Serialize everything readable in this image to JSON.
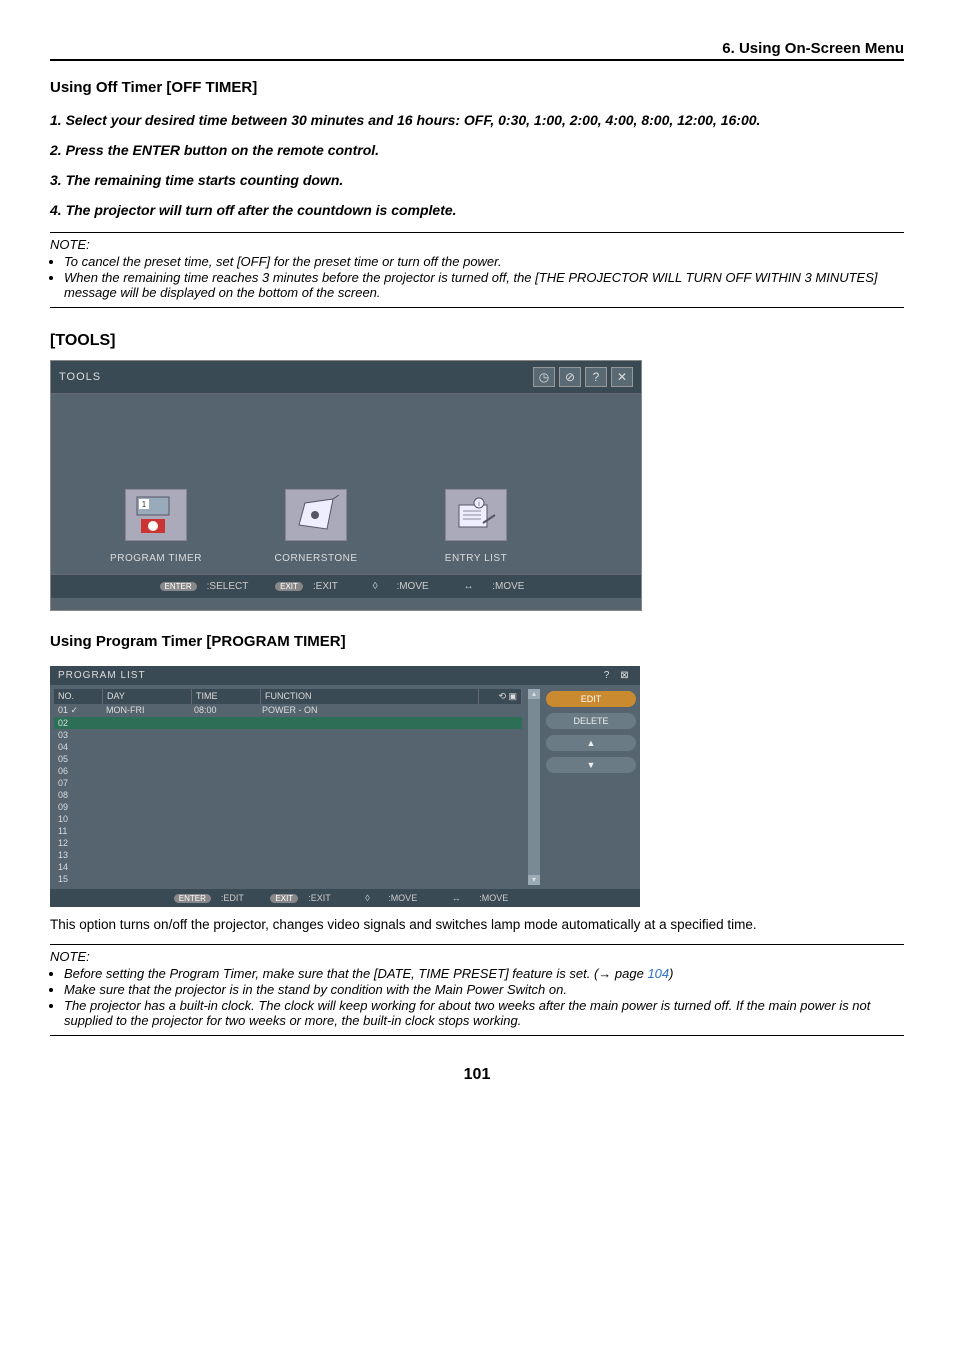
{
  "header": {
    "section": "6. Using On-Screen Menu"
  },
  "offtimer": {
    "heading": "Using Off Timer [OFF TIMER]",
    "steps": [
      "1.  Select your desired time between 30 minutes and 16 hours: OFF, 0:30, 1:00, 2:00, 4:00, 8:00, 12:00, 16:00.",
      "2.  Press the ENTER button on the remote control.",
      "3.  The remaining time starts counting down.",
      "4.  The projector will turn off after the countdown is complete."
    ],
    "note_title": "NOTE:",
    "notes": [
      "To cancel the preset time, set [OFF] for the preset time or turn off the power.",
      "When the remaining time reaches 3 minutes before the projector is turned off, the [THE PROJECTOR WILL TURN OFF WITHIN 3 MINUTES] message will be displayed on the bottom of the screen."
    ]
  },
  "tools": {
    "heading": "[TOOLS]",
    "title": "TOOLS",
    "items": [
      {
        "label": "PROGRAM TIMER"
      },
      {
        "label": "CORNERSTONE"
      },
      {
        "label": "ENTRY LIST"
      }
    ],
    "footer": {
      "enter": ":SELECT",
      "exit": ":EXIT",
      "ud": ":MOVE",
      "lr": ":MOVE",
      "enter_badge": "ENTER",
      "exit_badge": "EXIT",
      "ud_sym": "◊",
      "lr_sym": "↔"
    }
  },
  "progtimer": {
    "heading": "Using Program Timer [PROGRAM TIMER]",
    "title": "PROGRAM LIST",
    "columns": {
      "no": "NO.",
      "day": "DAY",
      "time": "TIME",
      "fn": "FUNCTION"
    },
    "col_icons": "⟲ ▣",
    "rows": [
      {
        "no": "01",
        "check": "✓",
        "day": "MON-FRI",
        "time": "08:00",
        "fn": "POWER - ON"
      },
      {
        "no": "02",
        "highlight": true
      },
      {
        "no": "03"
      },
      {
        "no": "04"
      },
      {
        "no": "05"
      },
      {
        "no": "06"
      },
      {
        "no": "07"
      },
      {
        "no": "08"
      },
      {
        "no": "09"
      },
      {
        "no": "10"
      },
      {
        "no": "11"
      },
      {
        "no": "12"
      },
      {
        "no": "13"
      },
      {
        "no": "14"
      },
      {
        "no": "15"
      }
    ],
    "side": {
      "edit": "EDIT",
      "delete": "DELETE",
      "up": "▲",
      "down": "▼"
    },
    "footer": {
      "enter_badge": "ENTER",
      "enter": ":EDIT",
      "exit_badge": "EXIT",
      "exit": ":EXIT",
      "ud_sym": "◊",
      "ud": ":MOVE",
      "lr_sym": "↔",
      "lr": ":MOVE"
    },
    "titlebar_icons": {
      "help": "?",
      "close": "⊠"
    },
    "desc": "This option turns on/off the projector, changes video signals and switches lamp mode automatically at a specified time.",
    "note_title": "NOTE:",
    "notes_pre": "Before setting the Program Timer, make sure that the [DATE, TIME PRESET] feature is set. (→ page ",
    "notes_link": "104",
    "notes_post": ")",
    "notes": [
      "Make sure that the projector is in the stand by condition with the Main Power Switch on.",
      "The projector has a built-in clock. The clock will keep working for about two weeks after the main power is turned off. If the main power is not supplied to the projector for two weeks or more, the built-in clock stops working."
    ]
  },
  "page": "101"
}
